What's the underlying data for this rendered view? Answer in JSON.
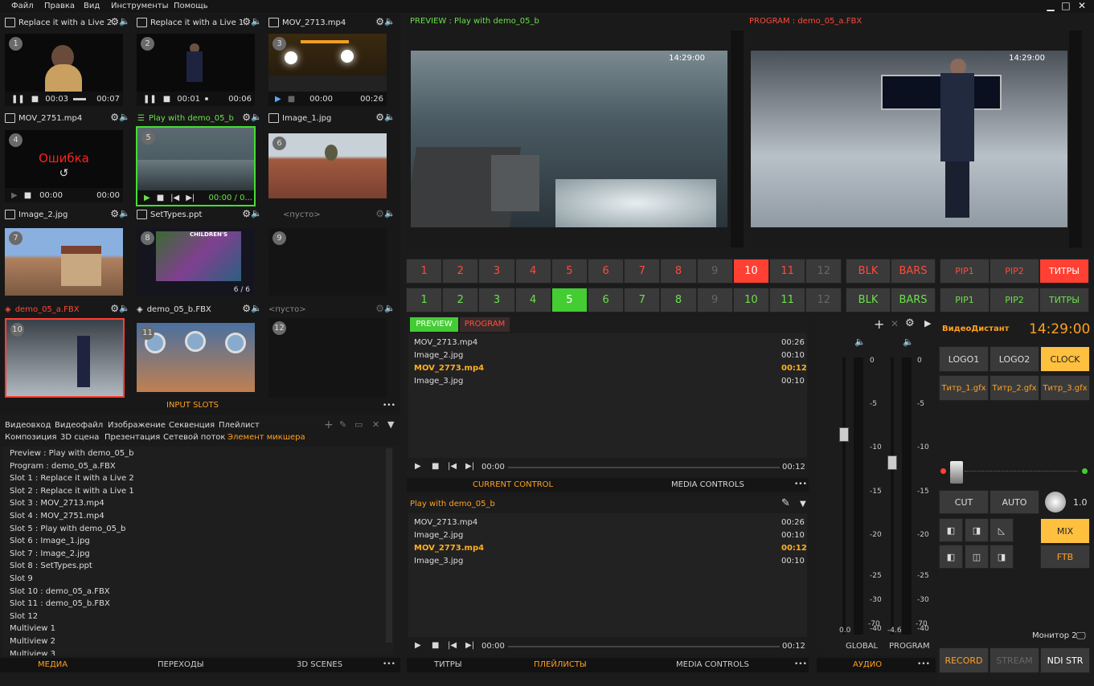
{
  "menu": [
    "Файл",
    "Правка",
    "Вид",
    "Инструменты",
    "Помощь"
  ],
  "window_controls": {
    "minimize": "▁",
    "maximize": "□",
    "close": "✕"
  },
  "slots": [
    {
      "num": "1",
      "title": "Replace it with a Live 2",
      "time": "00:03",
      "dur": "00:07"
    },
    {
      "num": "2",
      "title": "Replace it with a Live 1",
      "time": "00:01",
      "dur": "00:06"
    },
    {
      "num": "3",
      "title": "MOV_2713.mp4",
      "time": "00:00",
      "dur": "00:26"
    },
    {
      "num": "4",
      "title": "MOV_2751.mp4",
      "error": "Ошибка",
      "time": "00:00",
      "dur": "00:00"
    },
    {
      "num": "5",
      "title": "Play with demo_05_b",
      "time": "00:00 / 0..."
    },
    {
      "num": "6",
      "title": "Image_1.jpg"
    },
    {
      "num": "7",
      "title": "Image_2.jpg"
    },
    {
      "num": "8",
      "title": "SetTypes.ppt",
      "page": "6 / 6",
      "overlay_title": "CHILDREN'S"
    },
    {
      "num": "9",
      "title": "<пусто>"
    },
    {
      "num": "10",
      "title": "demo_05_a.FBX"
    },
    {
      "num": "11",
      "title": "demo_05_b.FBX"
    },
    {
      "num": "12",
      "title": "<пусто>"
    }
  ],
  "input_slots_label": "INPUT SLOTS",
  "more": "•••",
  "source_tabs_row1": [
    "Видеовход",
    "Видеофайл",
    "Изображение",
    "Секвенция",
    "Плейлист"
  ],
  "source_tabs_row2": [
    "Композиция",
    "3D сцена",
    "Презентация",
    "Сетевой поток",
    "Элемент микшера"
  ],
  "mixer_elements": [
    "Preview : Play with demo_05_b",
    "Program : demo_05_a.FBX",
    "Slot 1 : Replace it with a Live 2",
    "Slot 2 : Replace it with a Live 1",
    "Slot 3 : MOV_2713.mp4",
    "Slot 4 : MOV_2751.mp4",
    "Slot 5 : Play with demo_05_b",
    "Slot 6 : Image_1.jpg",
    "Slot 7 : Image_2.jpg",
    "Slot 8 : SetTypes.ppt",
    "Slot 9",
    "Slot 10 : demo_05_a.FBX",
    "Slot 11 : demo_05_b.FBX",
    "Slot 12",
    "Multiview 1",
    "Multiview 2",
    "Multiview 3"
  ],
  "left_bottom_tabs": [
    "МЕДИА",
    "ПЕРЕХОДЫ",
    "3D SCENES"
  ],
  "preview": {
    "label": "PREVIEW : Play with demo_05_b",
    "clock": "14:29:00"
  },
  "program": {
    "label": "PROGRAM : demo_05_a.FBX",
    "clock": "14:29:00"
  },
  "row_numbers": [
    "1",
    "2",
    "3",
    "4",
    "5",
    "6",
    "7",
    "8",
    "9",
    "10",
    "11",
    "12"
  ],
  "row_red_extra": [
    "BLK",
    "BARS"
  ],
  "row_green_extra": [
    "BLK",
    "BARS"
  ],
  "pip_red": [
    "PIP1",
    "PIP2",
    "ТИТРЫ"
  ],
  "pip_green": [
    "PIP1",
    "PIP2",
    "ТИТРЫ"
  ],
  "control_tabs": [
    "PREVIEW",
    "PROGRAM"
  ],
  "playlist": [
    {
      "name": "MOV_2713.mp4",
      "dur": "00:26"
    },
    {
      "name": "Image_2.jpg",
      "dur": "00:10"
    },
    {
      "name": "MOV_2773.mp4",
      "dur": "00:12",
      "active": true
    },
    {
      "name": "Image_3.jpg",
      "dur": "00:10"
    }
  ],
  "player": {
    "time": "00:00",
    "dur": "00:12"
  },
  "current_control_label": "CURRENT CONTROL",
  "media_controls_label": "MEDIA CONTROLS",
  "playlist_title": "Play with demo_05_b",
  "mid_bottom_tabs": [
    "ТИТРЫ",
    "ПЛЕЙЛИСТЫ",
    "MEDIA CONTROLS"
  ],
  "audio": {
    "scale": [
      "0",
      "-5",
      "-10",
      "-15",
      "-20",
      "-25",
      "-30",
      "-40",
      "-70"
    ],
    "global_value": "0.0",
    "program_value": "-4.6",
    "global_label": "GLOBAL",
    "program_label": "PROGRAM",
    "tab": "АУДИО"
  },
  "right": {
    "brand": "ВидеоДистант",
    "clock": "14:29:00",
    "logos": [
      "LOGO1",
      "LOGO2",
      "CLOCK"
    ],
    "titles": [
      "Титр_1.gfx",
      "Титр_2.gfx",
      "Титр_3.gfx"
    ],
    "cut": "CUT",
    "auto": "AUTO",
    "rate": "1.0",
    "mix": "MIX",
    "ftb": "FTB",
    "monitor": "Монитор 2",
    "bottom": [
      "RECORD",
      "STREAM",
      "NDI STR"
    ]
  }
}
